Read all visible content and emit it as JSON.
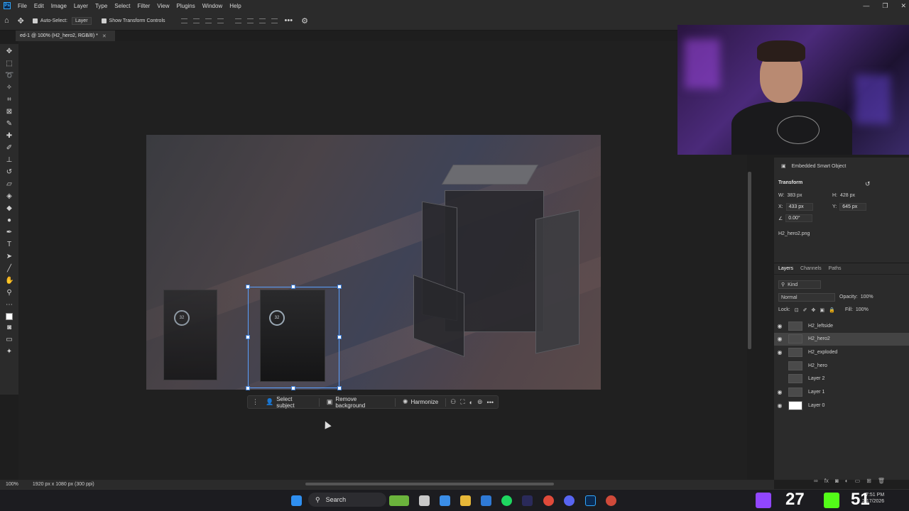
{
  "app": {
    "name": "Ps"
  },
  "menubar": {
    "items": [
      "File",
      "Edit",
      "Image",
      "Layer",
      "Type",
      "Select",
      "Filter",
      "View",
      "Plugins",
      "Window",
      "Help"
    ]
  },
  "options_bar": {
    "auto_select_label": "Auto-Select:",
    "auto_select_value": "Layer",
    "show_transform_label": "Show Transform Controls"
  },
  "document": {
    "tab_title": "ed-1 @ 100% (H2_hero2, RGB/8) *"
  },
  "canvas": {
    "fan_readout_1": "32",
    "fan_readout_2": "32"
  },
  "context_bar": {
    "select_subject": "Select subject",
    "remove_background": "Remove background",
    "harmonize": "Harmonize"
  },
  "properties": {
    "header": "Embedded Smart Object",
    "section_title": "Transform",
    "w_label": "W:",
    "w_value": "383 px",
    "h_label": "H:",
    "h_value": "428 px",
    "x_label": "X:",
    "x_value": "433 px",
    "y_label": "Y:",
    "y_value": "645 px",
    "angle_value": "0.00°",
    "filename": "H2_hero2.png"
  },
  "layers_panel": {
    "tabs": [
      "Layers",
      "Channels",
      "Paths"
    ],
    "filter_kind": "Kind",
    "blend_mode": "Normal",
    "opacity_label": "Opacity:",
    "opacity_value": "100%",
    "lock_label": "Lock:",
    "fill_label": "Fill:",
    "fill_value": "100%",
    "layers": [
      {
        "name": "H2_leftside",
        "visible": true,
        "selected": false
      },
      {
        "name": "H2_hero2",
        "visible": true,
        "selected": true
      },
      {
        "name": "H2_exploded",
        "visible": true,
        "selected": false
      },
      {
        "name": "H2_hero",
        "visible": false,
        "selected": false
      },
      {
        "name": "Layer 2",
        "visible": false,
        "selected": false
      },
      {
        "name": "Layer 1",
        "visible": true,
        "selected": false
      },
      {
        "name": "Layer 0",
        "visible": true,
        "selected": false
      }
    ]
  },
  "status_bar": {
    "zoom": "100%",
    "doc_info": "1920 px x 1080 px (300 ppi)"
  },
  "taskbar": {
    "search_label": "Search",
    "counter_left": "27",
    "counter_right": "51",
    "time": "7:51 PM",
    "date": "2/17/2026"
  },
  "colors": {
    "selection_accent": "#5aa0ff",
    "panel_bg": "#2b2b2b",
    "selected_layer_bg": "#444444"
  }
}
